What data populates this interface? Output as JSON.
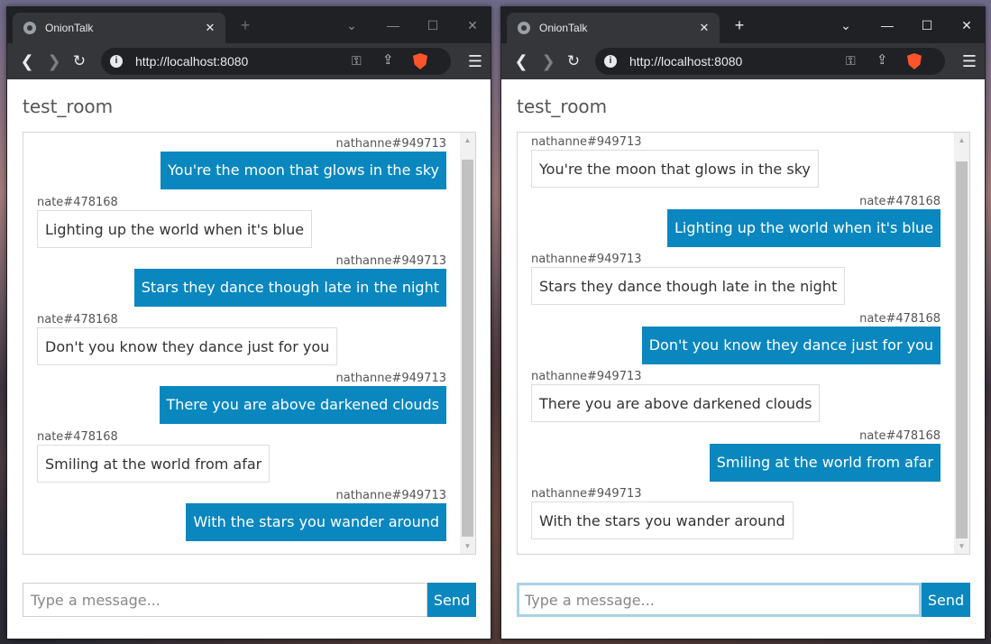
{
  "tab_title": "OnionTalk",
  "url": "http://localhost:8080",
  "room_name": "test_room",
  "input_placeholder": "Type a message...",
  "send_label": "Send",
  "icons": {
    "tab_close": "close-icon",
    "new_tab": "plus-icon",
    "tab_search": "chevron-down-icon",
    "minimize": "minimize-icon",
    "maximize": "maximize-icon",
    "window_close": "close-icon",
    "back": "arrow-left-icon",
    "forward": "arrow-right-icon",
    "reload": "reload-icon",
    "site_info": "info-icon",
    "key": "key-icon",
    "share": "share-icon",
    "brave_shield": "brave-lion-icon",
    "menu": "hamburger-menu-icon"
  },
  "colors": {
    "accent": "#0a87bf",
    "chrome_dark": "#202124",
    "chrome_mid": "#35363a"
  },
  "left_window": {
    "messages": [
      {
        "author": "nathanne#949713",
        "text": "You're the moon that glows in the sky",
        "mine": true
      },
      {
        "author": "nate#478168",
        "text": "Lighting up the world when it's blue",
        "mine": false
      },
      {
        "author": "nathanne#949713",
        "text": "Stars they dance though late in the night",
        "mine": true
      },
      {
        "author": "nate#478168",
        "text": "Don't you know they dance just for you",
        "mine": false
      },
      {
        "author": "nathanne#949713",
        "text": "There you are above darkened clouds",
        "mine": true
      },
      {
        "author": "nate#478168",
        "text": "Smiling at the world from afar",
        "mine": false
      },
      {
        "author": "nathanne#949713",
        "text": "With the stars you wander around",
        "mine": true
      }
    ]
  },
  "right_window": {
    "messages": [
      {
        "author": "nathanne#949713",
        "text": "You're the moon that glows in the sky",
        "mine": false
      },
      {
        "author": "nate#478168",
        "text": "Lighting up the world when it's blue",
        "mine": true
      },
      {
        "author": "nathanne#949713",
        "text": "Stars they dance though late in the night",
        "mine": false
      },
      {
        "author": "nate#478168",
        "text": "Don't you know they dance just for you",
        "mine": true
      },
      {
        "author": "nathanne#949713",
        "text": "There you are above darkened clouds",
        "mine": false
      },
      {
        "author": "nate#478168",
        "text": "Smiling at the world from afar",
        "mine": true
      },
      {
        "author": "nathanne#949713",
        "text": "With the stars you wander around",
        "mine": false
      }
    ]
  }
}
